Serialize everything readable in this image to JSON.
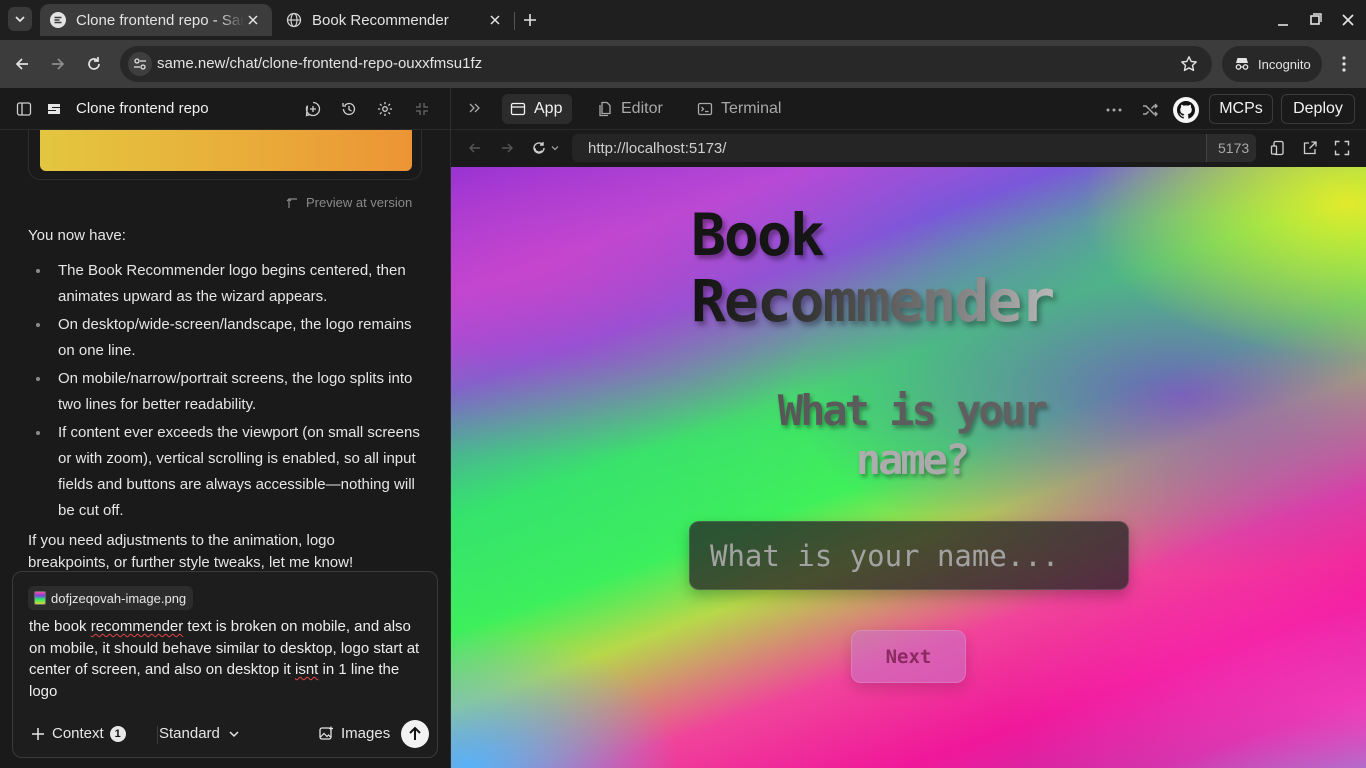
{
  "browser": {
    "tabs": [
      {
        "title": "Clone frontend repo - Same",
        "active": true
      },
      {
        "title": "Book Recommender",
        "active": false
      }
    ],
    "url": "same.new/chat/clone-frontend-repo-ouxxfmsu1fz",
    "incognito_label": "Incognito"
  },
  "left_panel": {
    "title": "Clone frontend repo",
    "preview_version_label": "Preview at version",
    "intro": "You now have:",
    "bullets": [
      "The Book Recommender logo begins centered, then animates upward as the wizard appears.",
      "On desktop/wide-screen/landscape, the logo remains on one line.",
      "On mobile/narrow/portrait screens, the logo splits into two lines for better readability.",
      "If content ever exceeds the viewport (on small screens or with zoom), vertical scrolling is enabled, so all input fields and buttons are always accessible—nothing will be cut off."
    ],
    "outro": "If you need adjustments to the animation, logo breakpoints, or further style tweaks, let me know!",
    "composer": {
      "attachment": "dofjzeqovah-image.png",
      "message_parts": [
        "the book ",
        "recommender",
        " text is broken on mobile, and also on mobile, it should behave similar to desktop, logo start at center of screen, and also on desktop it ",
        "isnt",
        " in 1 line the logo"
      ],
      "context_label": "Context",
      "context_count": "1",
      "mode_label": "Standard",
      "images_label": "Images"
    }
  },
  "right_panel": {
    "tabs": [
      "App",
      "Editor",
      "Terminal"
    ],
    "active_tab": "App",
    "mcps_label": "MCPs",
    "deploy_label": "Deploy",
    "preview_url": "http://localhost:5173/",
    "port": "5173"
  },
  "app": {
    "logo_line1": "Book",
    "logo_line2": "Recommender",
    "question_line1": "What is your",
    "question_line2": "name?",
    "input_placeholder": "What is your name...",
    "next_label": "Next"
  },
  "colors": {
    "accent_yellow": "#e9ad3a",
    "panel_bg": "#1a1a1a",
    "chrome_bg": "#3c3c3c"
  }
}
